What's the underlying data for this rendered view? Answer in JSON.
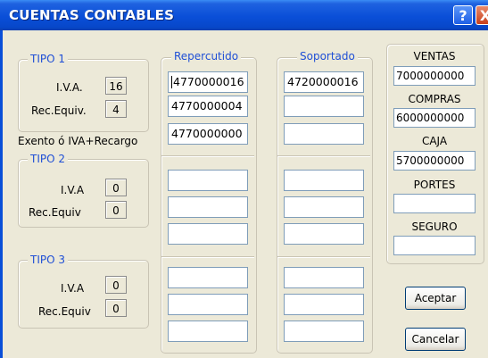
{
  "window": {
    "title": "CUENTAS CONTABLES",
    "help_label": "?",
    "close_label": "X"
  },
  "tipo1": {
    "legend": "TIPO 1",
    "iva_label": "I.V.A.",
    "iva_value": "16",
    "rec_label": "Rec.Equiv.",
    "rec_value": "4"
  },
  "exento_label": "Exento ó IVA+Recargo",
  "tipo2": {
    "legend": "TIPO 2",
    "iva_label": "I.V.A",
    "iva_value": "0",
    "rec_label": "Rec.Equiv",
    "rec_value": "0"
  },
  "tipo3": {
    "legend": "TIPO 3",
    "iva_label": "I.V.A",
    "iva_value": "0",
    "rec_label": "Rec.Equiv",
    "rec_value": "0"
  },
  "repercutido": {
    "legend": "Repercutido",
    "fields": [
      "4770000016",
      "4770000004",
      "4770000000",
      "",
      "",
      "",
      "",
      "",
      ""
    ]
  },
  "soportado": {
    "legend": "Soportado",
    "fields": [
      "4720000016",
      "",
      "",
      "",
      "",
      "",
      "",
      "",
      ""
    ]
  },
  "side": {
    "ventas_label": "VENTAS",
    "ventas_value": "7000000000",
    "compras_label": "COMPRAS",
    "compras_value": "6000000000",
    "caja_label": "CAJA",
    "caja_value": "5700000000",
    "portes_label": "PORTES",
    "portes_value": "",
    "seguro_label": "SEGURO",
    "seguro_value": ""
  },
  "buttons": {
    "accept_label": "Aceptar",
    "cancel_label": "Cancelar"
  }
}
